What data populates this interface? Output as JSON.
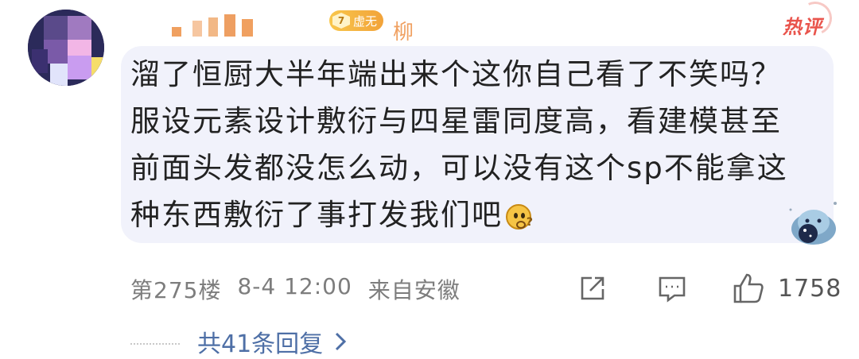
{
  "user": {
    "name_visible": "柳",
    "level": "7",
    "title_badge": "虚无"
  },
  "tags": {
    "hot": "热评"
  },
  "comment": {
    "lines": [
      "溜了恒厨大半年端出来个这你自己看了不笑吗？",
      "服设元素设计敷衍与四星雷同度高，看建模甚至",
      "前面头发都没怎么动，可以没有这个sp不能拿这",
      "种东西敷衍了事打发我们吧"
    ],
    "emoji": "thinking-face-icon"
  },
  "meta": {
    "floor": "第275楼",
    "datetime": "8-4 12:00",
    "source": "来自安徽"
  },
  "actions": {
    "share_icon": "share-icon",
    "reply_icon": "comment-icon",
    "like_icon": "thumb-up-icon",
    "like_count": "1758"
  },
  "replies": {
    "label": "共41条回复",
    "chevron": "chevron-right-icon"
  },
  "colors": {
    "bubble": "#f1f2fb",
    "hot": "#e8463d",
    "link": "#4e6fa6",
    "badge": "#f2a33a"
  }
}
